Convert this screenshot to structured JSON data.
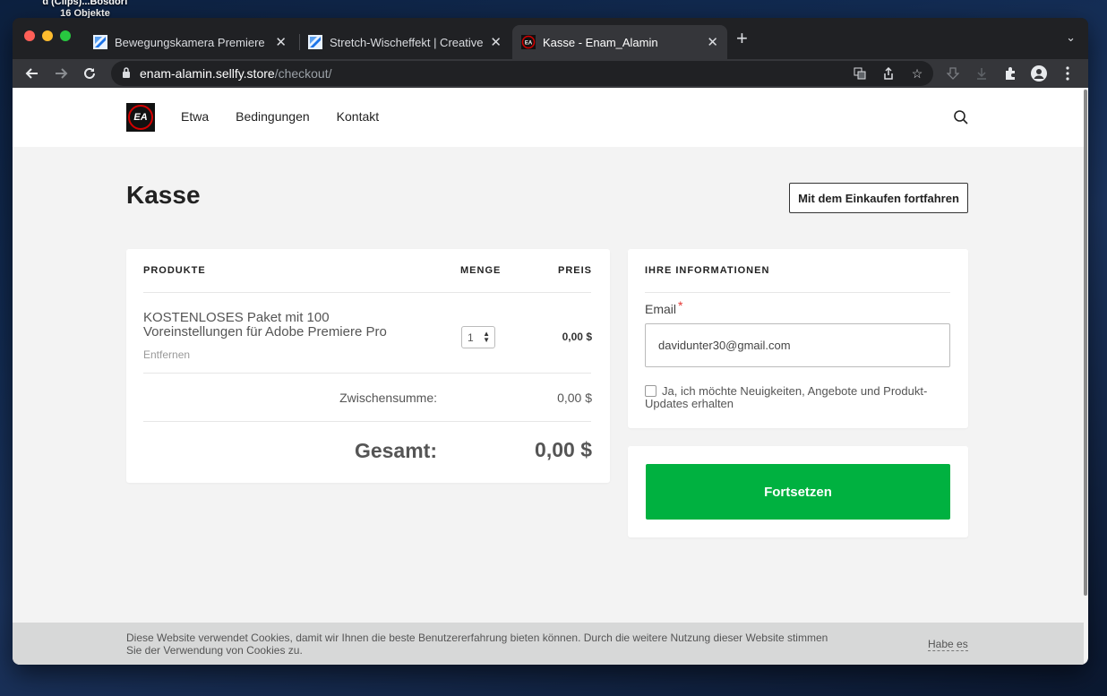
{
  "desktop": {
    "label": "d (Clips)...Bosdorf",
    "sublabel": "16 Objekte"
  },
  "browser": {
    "tabs": [
      {
        "title": "Bewegungskamera Premiere Pr",
        "active": false
      },
      {
        "title": "Stretch-Wischeffekt | Creative",
        "active": false
      },
      {
        "title": "Kasse - Enam_Alamin",
        "active": true
      }
    ],
    "url_host": "enam-alamin.sellfy.store",
    "url_path": "/checkout/"
  },
  "site": {
    "nav": [
      "Etwa",
      "Bedingungen",
      "Kontakt"
    ],
    "logo_text": "EA"
  },
  "checkout": {
    "title": "Kasse",
    "continue_shopping": "Mit dem Einkaufen fortfahren",
    "columns": {
      "products": "PRODUKTE",
      "quantity": "MENGE",
      "price": "PREIS"
    },
    "item": {
      "name": "KOSTENLOSES Paket mit 100 Voreinstellungen für Adobe Premiere Pro",
      "remove": "Entfernen",
      "quantity": "1",
      "price": "0,00 $"
    },
    "subtotal_label": "Zwischensumme:",
    "subtotal_value": "0,00 $",
    "total_label": "Gesamt:",
    "total_value": "0,00 $",
    "info_heading": "IHRE INFORMATIONEN",
    "email_label": "Email",
    "email_required_mark": "*",
    "email_value": "davidunter30@gmail.com",
    "newsletter_label": "Ja, ich möchte Neuigkeiten, Angebote und Produkt-Updates erhalten",
    "continue_button": "Fortsetzen"
  },
  "cookie": {
    "text": "Diese Website verwendet Cookies, damit wir Ihnen die beste Benutzererfahrung bieten können. Durch die weitere Nutzung dieser Website stimmen Sie der Verwendung von Cookies zu.",
    "accept": "Habe es"
  },
  "colors": {
    "accent_green": "#00b140",
    "required_red": "#e53935"
  }
}
